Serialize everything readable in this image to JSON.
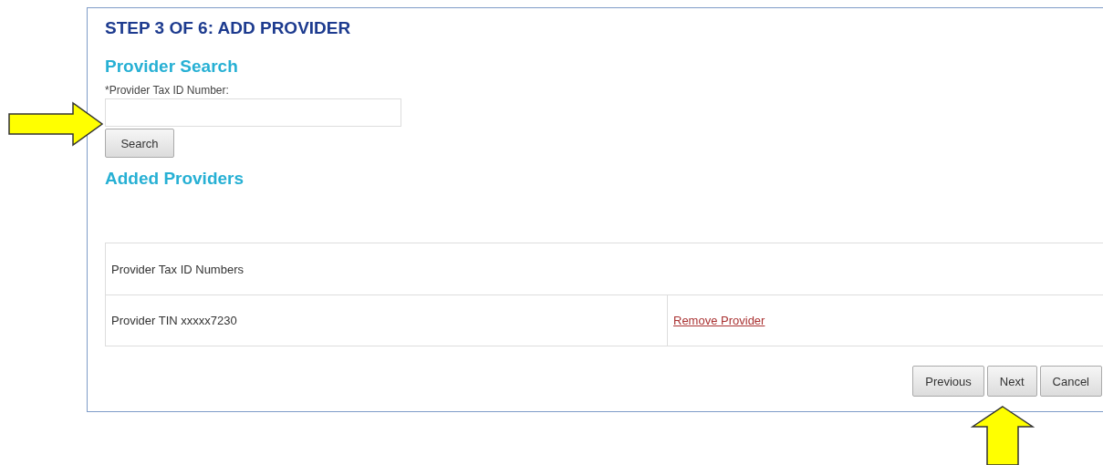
{
  "page": {
    "title": "STEP 3 OF 6: ADD PROVIDER"
  },
  "provider_search": {
    "heading": "Provider Search",
    "field_label": "*Provider Tax ID Number:",
    "button": "Search"
  },
  "added_providers": {
    "heading": "Added Providers",
    "table": {
      "header": "Provider Tax ID Numbers",
      "rows": [
        {
          "tin": "Provider TIN xxxxx7230",
          "action": "Remove Provider"
        }
      ]
    }
  },
  "buttons": [
    "Previous",
    "Next",
    "Cancel"
  ]
}
